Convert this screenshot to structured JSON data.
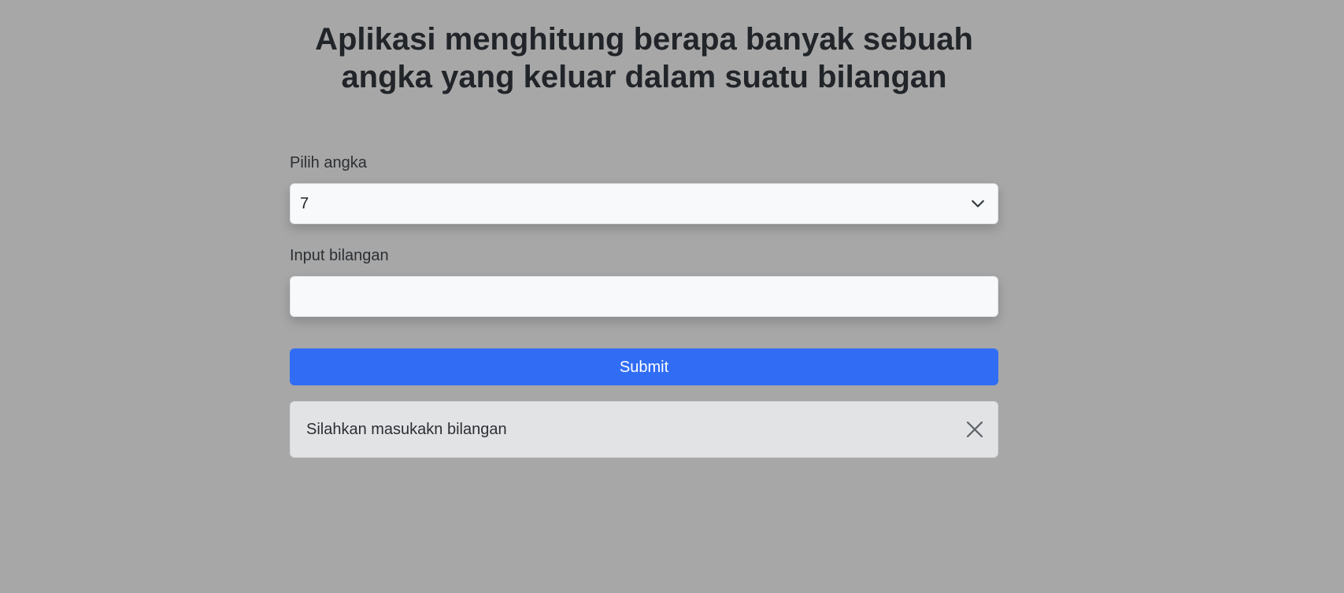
{
  "header": {
    "title": "Aplikasi menghitung berapa banyak sebuah angka yang keluar dalam suatu bilangan"
  },
  "form": {
    "select_label": "Pilih angka",
    "select_value": "7",
    "input_label": "Input bilangan",
    "input_value": "",
    "submit_label": "Submit"
  },
  "alert": {
    "message": "Silahkan masukakn bilangan",
    "close_icon": "close-icon"
  },
  "icons": {
    "select": "chevron-down-icon"
  },
  "colors": {
    "background": "#a7a7a7",
    "primary": "#316df4",
    "alert_background": "#e2e3e5"
  }
}
